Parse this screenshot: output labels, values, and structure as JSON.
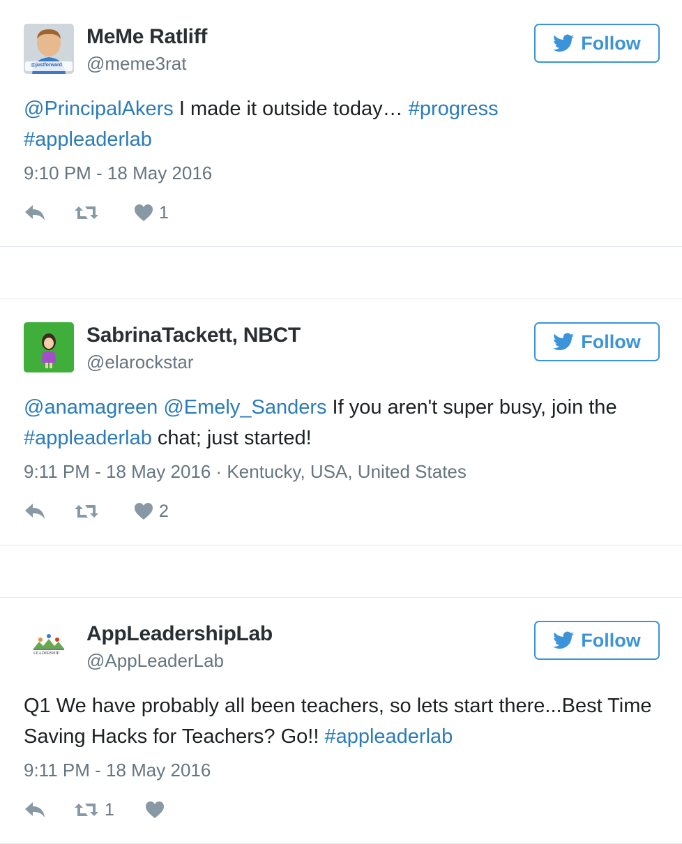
{
  "colors": {
    "link": "#2b7bb9",
    "follow": "#3b94d9",
    "muted": "#66757f",
    "icon": "#8899a6",
    "border": "#e1e8ed"
  },
  "tweets": [
    {
      "name": "MeMe Ratliff",
      "handle": "@meme3rat",
      "follow_label": "Follow",
      "avatar_text": "@justforward",
      "text_parts": [
        {
          "t": "@PrincipalAkers",
          "link": true
        },
        {
          "t": " I made it outside today… ",
          "link": false
        },
        {
          "t": "#progress",
          "link": true
        },
        {
          "t": " ",
          "link": false
        },
        {
          "t": "#appleaderlab",
          "link": true
        }
      ],
      "meta": "9:10 PM - 18 May 2016",
      "retweets": "",
      "likes": "1"
    },
    {
      "name": "SabrinaTackett, NBCT",
      "handle": "@elarockstar",
      "follow_label": "Follow",
      "text_parts": [
        {
          "t": "@anamagreen",
          "link": true
        },
        {
          "t": " ",
          "link": false
        },
        {
          "t": "@Emely_Sanders",
          "link": true
        },
        {
          "t": " If you aren't super busy, join the ",
          "link": false
        },
        {
          "t": "#appleaderlab",
          "link": true
        },
        {
          "t": " chat; just started!",
          "link": false
        }
      ],
      "meta": "9:11 PM - 18 May 2016 · Kentucky, USA, United States",
      "retweets": "",
      "likes": "2"
    },
    {
      "name": "AppLeadershipLab",
      "handle": "@AppLeaderLab",
      "follow_label": "Follow",
      "avatar_text": "LEADERSHIP",
      "text_parts": [
        {
          "t": "Q1 We have probably all been teachers, so lets start there...Best Time Saving Hacks for Teachers? Go!! ",
          "link": false
        },
        {
          "t": "#appleaderlab",
          "link": true
        }
      ],
      "meta": "9:11 PM - 18 May 2016",
      "retweets": "1",
      "likes": ""
    }
  ]
}
